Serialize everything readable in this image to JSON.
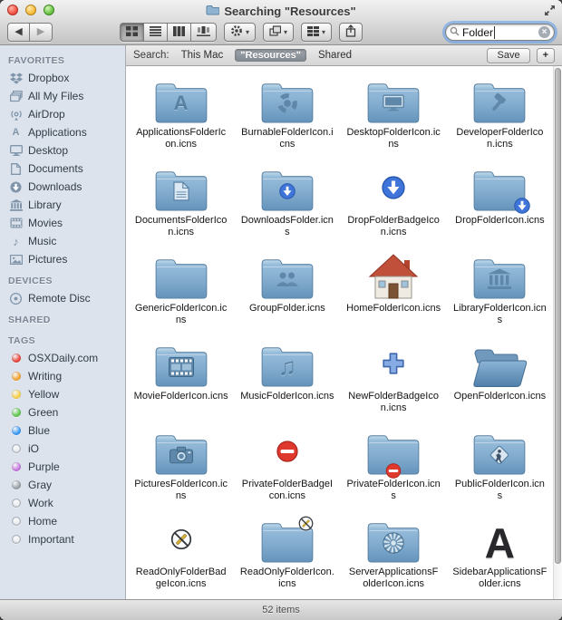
{
  "window": {
    "title": "Searching \"Resources\"",
    "status": "52 items"
  },
  "toolbar": {
    "search_value": "Folder",
    "icons": [
      "back-icon",
      "forward-icon",
      "icon-view-icon",
      "list-view-icon",
      "column-view-icon",
      "coverflow-view-icon",
      "gear-icon",
      "arrange-layers-icon",
      "group-tiles-icon",
      "share-icon",
      "search-icon",
      "clear-search-icon"
    ]
  },
  "scope_bar": {
    "label": "Search:",
    "scopes": [
      {
        "label": "This Mac",
        "selected": false
      },
      {
        "label": "\"Resources\"",
        "selected": true
      },
      {
        "label": "Shared",
        "selected": false
      }
    ],
    "save_label": "Save",
    "add_label": "+"
  },
  "sidebar": {
    "sections": [
      {
        "title": "FAVORITES",
        "items": [
          {
            "label": "Dropbox",
            "icon": "dropbox-icon"
          },
          {
            "label": "All My Files",
            "icon": "all-my-files-icon"
          },
          {
            "label": "AirDrop",
            "icon": "airdrop-icon"
          },
          {
            "label": "Applications",
            "icon": "applications-icon"
          },
          {
            "label": "Desktop",
            "icon": "desktop-icon"
          },
          {
            "label": "Documents",
            "icon": "documents-icon"
          },
          {
            "label": "Downloads",
            "icon": "downloads-icon"
          },
          {
            "label": "Library",
            "icon": "library-icon"
          },
          {
            "label": "Movies",
            "icon": "movies-icon"
          },
          {
            "label": "Music",
            "icon": "music-icon"
          },
          {
            "label": "Pictures",
            "icon": "pictures-icon"
          }
        ]
      },
      {
        "title": "DEVICES",
        "items": [
          {
            "label": "Remote Disc",
            "icon": "remote-disc-icon"
          }
        ]
      },
      {
        "title": "SHARED",
        "items": []
      },
      {
        "title": "TAGS",
        "items": [
          {
            "label": "OSXDaily.com",
            "tag_color": "#e8463c"
          },
          {
            "label": "Writing",
            "tag_color": "#f5a434"
          },
          {
            "label": "Yellow",
            "tag_color": "#f7d04b"
          },
          {
            "label": "Green",
            "tag_color": "#5fc84f"
          },
          {
            "label": "Blue",
            "tag_color": "#3a99f5"
          },
          {
            "label": "iO",
            "tag_color": null
          },
          {
            "label": "Purple",
            "tag_color": "#c678e0"
          },
          {
            "label": "Gray",
            "tag_color": "#9aa1a8"
          },
          {
            "label": "Work",
            "tag_color": null
          },
          {
            "label": "Home",
            "tag_color": null
          },
          {
            "label": "Important",
            "tag_color": null
          }
        ]
      }
    ]
  },
  "grid": {
    "items": [
      {
        "label": "ApplicationsFolderIcon.icns",
        "icon": "applications-folder-icon",
        "kind": "folder",
        "overlay": "letter-a",
        "overlay_pos": "center"
      },
      {
        "label": "BurnableFolderIcon.icns",
        "icon": "burnable-folder-icon",
        "kind": "folder",
        "overlay": "burn",
        "overlay_pos": "center"
      },
      {
        "label": "DesktopFolderIcon.icns",
        "icon": "desktop-folder-icon",
        "kind": "folder",
        "overlay": "desktop",
        "overlay_pos": "center"
      },
      {
        "label": "DeveloperFolderIcon.icns",
        "icon": "developer-folder-icon",
        "kind": "folder",
        "overlay": "hammer",
        "overlay_pos": "center"
      },
      {
        "label": "DocumentsFolderIcon.icns",
        "icon": "documents-folder-icon",
        "kind": "folder",
        "overlay": "document",
        "overlay_pos": "center"
      },
      {
        "label": "DownloadsFolder.icns",
        "icon": "downloads-folder-icon",
        "kind": "folder",
        "overlay": "download",
        "overlay_pos": "center"
      },
      {
        "label": "DropFolderBadgeIcon.icns",
        "icon": "drop-folder-badge-icon",
        "kind": "badge",
        "overlay": "download",
        "overlay_pos": "center"
      },
      {
        "label": "DropFolderIcon.icns",
        "icon": "drop-folder-icon",
        "kind": "folder",
        "overlay": "download",
        "overlay_pos": "bottom-right"
      },
      {
        "label": "GenericFolderIcon.icns",
        "icon": "generic-folder-icon",
        "kind": "folder",
        "overlay": null,
        "overlay_pos": null
      },
      {
        "label": "GroupFolder.icns",
        "icon": "group-folder-icon",
        "kind": "folder",
        "overlay": "people",
        "overlay_pos": "center"
      },
      {
        "label": "HomeFolderIcon.icns",
        "icon": "home-folder-icon",
        "kind": "house",
        "overlay": null,
        "overlay_pos": null
      },
      {
        "label": "LibraryFolderIcon.icns",
        "icon": "library-folder-icon",
        "kind": "folder",
        "overlay": "columns",
        "overlay_pos": "center"
      },
      {
        "label": "MovieFolderIcon.icns",
        "icon": "movie-folder-icon",
        "kind": "folder",
        "overlay": "film",
        "overlay_pos": "center"
      },
      {
        "label": "MusicFolderIcon.icns",
        "icon": "music-folder-icon",
        "kind": "folder",
        "overlay": "note",
        "overlay_pos": "center"
      },
      {
        "label": "NewFolderBadgeIcon.icns",
        "icon": "new-folder-badge-icon",
        "kind": "badge",
        "overlay": "plus",
        "overlay_pos": "center"
      },
      {
        "label": "OpenFolderIcon.icns",
        "icon": "open-folder-icon",
        "kind": "open-folder",
        "overlay": null,
        "overlay_pos": null
      },
      {
        "label": "PicturesFolderIcon.icns",
        "icon": "pictures-folder-icon",
        "kind": "folder",
        "overlay": "camera",
        "overlay_pos": "center"
      },
      {
        "label": "PrivateFolderBadgeIcon.icns",
        "icon": "private-folder-badge-icon",
        "kind": "badge",
        "overlay": "no-entry",
        "overlay_pos": "center"
      },
      {
        "label": "PrivateFolderIcon.icns",
        "icon": "private-folder-icon",
        "kind": "folder",
        "overlay": "no-entry",
        "overlay_pos": "bottom-center"
      },
      {
        "label": "PublicFolderIcon.icns",
        "icon": "public-folder-icon",
        "kind": "folder",
        "overlay": "walker",
        "overlay_pos": "center"
      },
      {
        "label": "ReadOnlyFolderBadgeIcon.icns",
        "icon": "read-only-folder-badge-icon",
        "kind": "badge",
        "overlay": "read-only",
        "overlay_pos": "center"
      },
      {
        "label": "ReadOnlyFolderIcon.icns",
        "icon": "read-only-folder-icon",
        "kind": "folder",
        "overlay": "read-only",
        "overlay_pos": "top-right"
      },
      {
        "label": "ServerApplicationsFolderIcon.icns",
        "icon": "server-applications-folder-icon",
        "kind": "folder",
        "overlay": "gear-burst",
        "overlay_pos": "center"
      },
      {
        "label": "SidebarApplicationsFolder.icns",
        "icon": "sidebar-applications-folder-icon",
        "kind": "letter-a-dark",
        "overlay": null,
        "overlay_pos": null
      }
    ]
  }
}
